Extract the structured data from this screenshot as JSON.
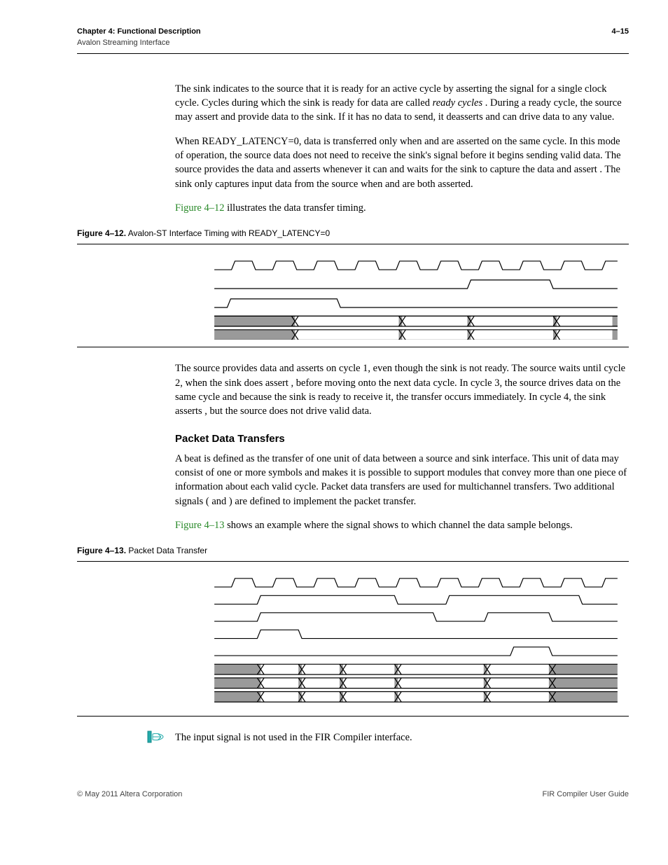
{
  "header": {
    "chapter": "Chapter 4: Functional Description",
    "section": "Avalon Streaming Interface",
    "page": "4–15"
  },
  "p1_a": "The sink indicates to the source that it is ready for an active cycle by asserting the ",
  "p1_b": " signal for a single clock cycle. Cycles during which the sink is ready for data are called ",
  "p1_c": "ready cycles",
  "p1_d": ". During a ready cycle, the source may assert ",
  "p1_e": " and provide data to the sink. If it has no data to send, it deasserts ",
  "p1_f": " and can drive data to any value.",
  "p2_a": "When READY_LATENCY=0, data is transferred only when ",
  "p2_b": " and ",
  "p2_c": " are asserted on the same cycle. In this mode of operation, the source data does not need to receive the sink's ",
  "p2_d": " signal before it begins sending valid data. The source provides the data and asserts ",
  "p2_e": " whenever it can and waits for the sink to capture the data and assert ",
  "p2_f": ". The sink only captures input data from the source when ",
  "p2_g": " and ",
  "p2_h": " are both asserted.",
  "p3_a": "Figure 4–12",
  "p3_b": " illustrates the data transfer timing.",
  "fig12": {
    "label": "Figure 4–12.",
    "title": " Avalon-ST Interface Timing with READY_LATENCY=0"
  },
  "p4_a": "The source provides data and asserts ",
  "p4_b": " on cycle 1, even though the sink is not ready. The source waits until cycle 2, when the sink does assert ",
  "p4_c": ", before moving onto the next data cycle. In cycle 3, the source drives data on the same cycle and because the sink is ready to receive it, the transfer occurs immediately. In cycle 4, the sink asserts ",
  "p4_d": ", but the source does not drive valid data.",
  "h3_packet": "Packet Data Transfers",
  "p5_a": "A beat is defined as the transfer of one unit of data between a source and sink interface. This unit of data may consist of one or more symbols and makes it is possible to support modules that convey more than one piece of information about each valid cycle. Packet data transfers are used for multichannel transfers. Two additional signals (",
  "p5_b": " and ",
  "p5_c": ") are defined to implement the packet transfer.",
  "p6_a": "Figure 4–13",
  "p6_b": " shows an example where the ",
  "p6_c": " signal shows to which channel the data sample belongs.",
  "fig13": {
    "label": "Figure 4–13.",
    "title": " Packet Data Transfer"
  },
  "note_a": "The ",
  "note_b": " input signal is not used in the FIR Compiler interface.",
  "footer": {
    "left": "© May 2011   Altera Corporation",
    "right": "FIR Compiler User Guide"
  }
}
